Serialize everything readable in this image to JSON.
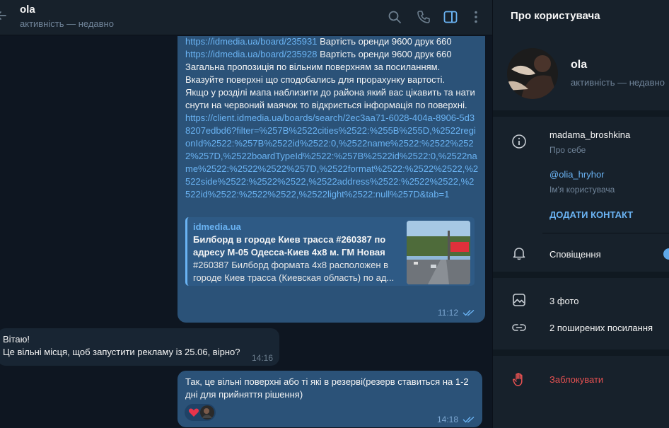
{
  "chat": {
    "title": "ola",
    "status": "активність — недавно"
  },
  "messages": {
    "m1": {
      "lines": [
        {
          "link": "https://idmedia.ua/board/235931",
          "text": " Вартість оренди 9600 друк 660"
        },
        {
          "link": "https://idmedia.ua/board/235928",
          "text": " Вартість оренди 9600 друк 660"
        }
      ],
      "body": "Загальна пропозиція по вільним поверхням за посиланням.\nВказуйте поверхні що сподобались для прорахунку вартості.\nЯкщо у розділі мапа наблизити до района який вас цікавить та натиснути на червоний маячок то відкриється інформація по поверхні.",
      "long_link": "https://client.idmedia.ua/boards/search/2ec3aa71-6028-404a-8906-5d38207edbd6?filter=%257B%2522cities%2522:%255B%255D,%2522regionId%2522:%257B%2522id%2522:0,%2522name%2522:%2522%2522%257D,%2522boardTypeId%2522:%257B%2522id%2522:0,%2522name%2522:%2522%2522%257D,%2522format%2522:%2522%2522,%2522side%2522:%2522%2522,%2522address%2522:%2522%2522,%2522id%2522:%2522%2522,%2522light%2522:null%257D&tab=1",
      "preview": {
        "site": "idmedia.ua",
        "title": "Билборд в городе Киев трасса #260387 по адресу М-05 Одесса-Киев 4x8 м. ГМ Новая Л...",
        "desc": "#260387 Билборд формата 4x8 расположен в городе Киев трасса (Киевская область) по ад..."
      },
      "time": "11:12"
    },
    "m2": {
      "text": "Вітаю!\nЦе вільні місця, щоб запустити рекламу із 25.06, вірно?",
      "time": "14:16"
    },
    "m3": {
      "text": "Так, це вільні поверхні або ті які в резерві(резерв ставиться на 1-2 дні для прийняття рішення)",
      "time": "14:18"
    }
  },
  "panel": {
    "title": "Про користувача",
    "name": "ola",
    "status": "активність — недавно",
    "bio": "madama_broshkina",
    "bio_label": "Про себе",
    "username": "@olia_hryhor",
    "username_label": "Ім'я користувача",
    "add_contact": "ДОДАТИ КОНТАКТ",
    "notifications": "Сповіщення",
    "photos": "3 фото",
    "links": "2 поширених посилання",
    "block": "Заблокувати"
  },
  "colors": {
    "accent": "#6ab3f3",
    "outgoing_bubble": "#2b5278",
    "incoming_bubble": "#182533",
    "danger": "#e55151"
  }
}
